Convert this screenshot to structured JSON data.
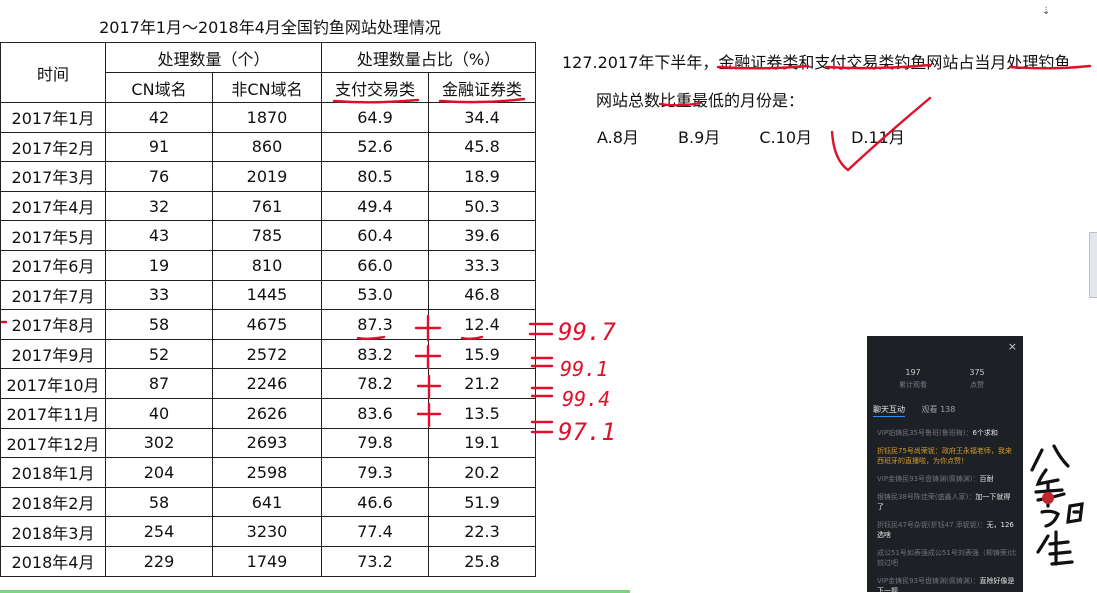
{
  "table": {
    "title": "2017年1月～2018年4月全国钓鱼网站处理情况",
    "header_time": "时间",
    "group1": "处理数量（个）",
    "group2": "处理数量占比（%）",
    "sub1": "CN域名",
    "sub2": "非CN域名",
    "sub3": "支付交易类",
    "sub4": "金融证券类",
    "rows": [
      [
        "2017年1月",
        "42",
        "1870",
        "64.9",
        "34.4"
      ],
      [
        "2017年2月",
        "91",
        "860",
        "52.6",
        "45.8"
      ],
      [
        "2017年3月",
        "76",
        "2019",
        "80.5",
        "18.9"
      ],
      [
        "2017年4月",
        "32",
        "761",
        "49.4",
        "50.3"
      ],
      [
        "2017年5月",
        "43",
        "785",
        "60.4",
        "39.6"
      ],
      [
        "2017年6月",
        "19",
        "810",
        "66.0",
        "33.3"
      ],
      [
        "2017年7月",
        "33",
        "1445",
        "53.0",
        "46.8"
      ],
      [
        "2017年8月",
        "58",
        "4675",
        "87.3",
        "12.4"
      ],
      [
        "2017年9月",
        "52",
        "2572",
        "83.2",
        "15.9"
      ],
      [
        "2017年10月",
        "87",
        "2246",
        "78.2",
        "21.2"
      ],
      [
        "2017年11月",
        "40",
        "2626",
        "83.6",
        "13.5"
      ],
      [
        "2017年12月",
        "302",
        "2693",
        "79.8",
        "19.1"
      ],
      [
        "2018年1月",
        "204",
        "2598",
        "79.3",
        "20.2"
      ],
      [
        "2018年2月",
        "58",
        "641",
        "46.6",
        "51.9"
      ],
      [
        "2018年3月",
        "254",
        "3230",
        "77.4",
        "22.3"
      ],
      [
        "2018年4月",
        "229",
        "1749",
        "73.2",
        "25.8"
      ]
    ]
  },
  "question": {
    "line1": "127.2017年下半年，金融证券类和支付交易类钓鱼网站占当月处理钓鱼",
    "line2": "网站总数比重最低的月份是：",
    "choices": [
      "A.8月",
      "B.9月",
      "C.10月",
      "D.11月"
    ]
  },
  "annotations": {
    "sums": [
      "99.7",
      "99.1",
      "99.4",
      "97.1"
    ],
    "plus": "+",
    "equals": "="
  },
  "live_panel": {
    "close": "×",
    "views": "197",
    "views_caption": "累计观看",
    "likes": "375",
    "likes_caption": "点赞",
    "tab_chat": "聊天互动",
    "tab_viewers": "观看 138",
    "messages": [
      {
        "text": "VIP铂铸民35号鲁班(鲁班梅)：",
        "bold": "6个求和"
      },
      {
        "text": "折钰民75号尚荣铌：政府王永福老师，我来西班牙的直播啦，为你点赞！",
        "bold": "",
        "hl": true
      },
      {
        "text": "VIP金铸民93号盘铸渊(佩铸渊)：",
        "bold": "百耐"
      },
      {
        "text": "银铸民38号陈佳荣(盛鑫人家)：",
        "bold": "加一下就得了"
      },
      {
        "text": "折钰民47号杂铌(折钰47 添铌铌)：",
        "bold": "无，126选啥"
      },
      {
        "text": "成公51号如表强成公51号刘表强（柳铸荣)比较过吧",
        "bold": ""
      },
      {
        "text": "VIP金铸民93号盘铸渊(佩铸渊)：",
        "bold": "直除好像是下一题"
      }
    ]
  },
  "logo_text": [
    "公",
    "考",
    "思",
    "维"
  ],
  "logo_seal": "公考"
}
